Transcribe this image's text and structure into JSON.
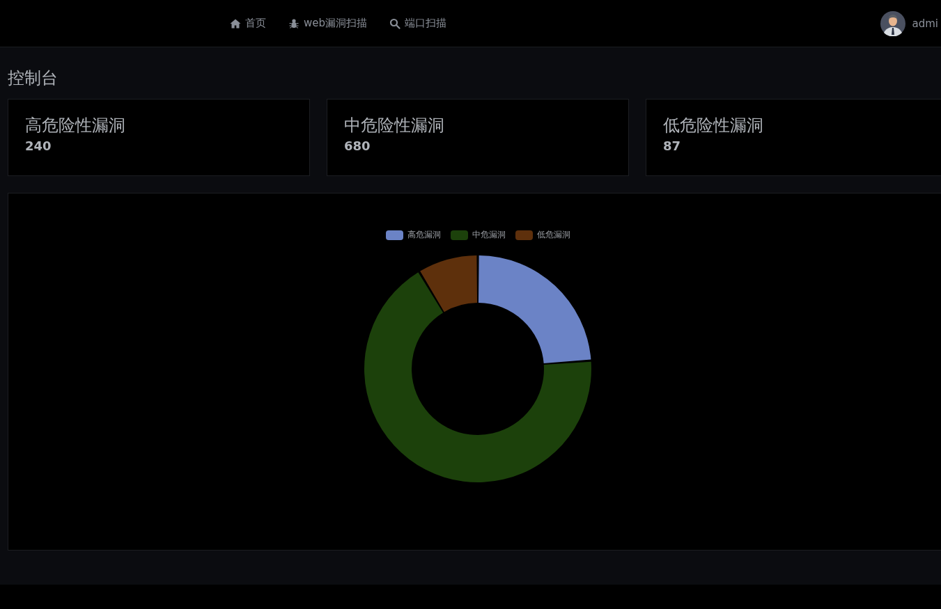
{
  "nav": {
    "links": [
      {
        "kind": "home",
        "label": "首页"
      },
      {
        "kind": "bug",
        "label": "web漏洞扫描"
      },
      {
        "kind": "search",
        "label": "端口扫描"
      }
    ],
    "user": "admi"
  },
  "page_title": "控制台",
  "stat_cards": [
    {
      "title": "高危险性漏洞",
      "value": "240"
    },
    {
      "title": "中危险性漏洞",
      "value": "680"
    },
    {
      "title": "低危险性漏洞",
      "value": "87"
    }
  ],
  "chart_data": {
    "type": "donut",
    "categories": [
      "高危漏洞",
      "中危漏洞",
      "低危漏洞"
    ],
    "values": [
      23.83,
      67.53,
      8.64
    ],
    "legend": "top",
    "colors": [
      "#6b83c6",
      "#1c410b",
      "#5e300c"
    ]
  }
}
